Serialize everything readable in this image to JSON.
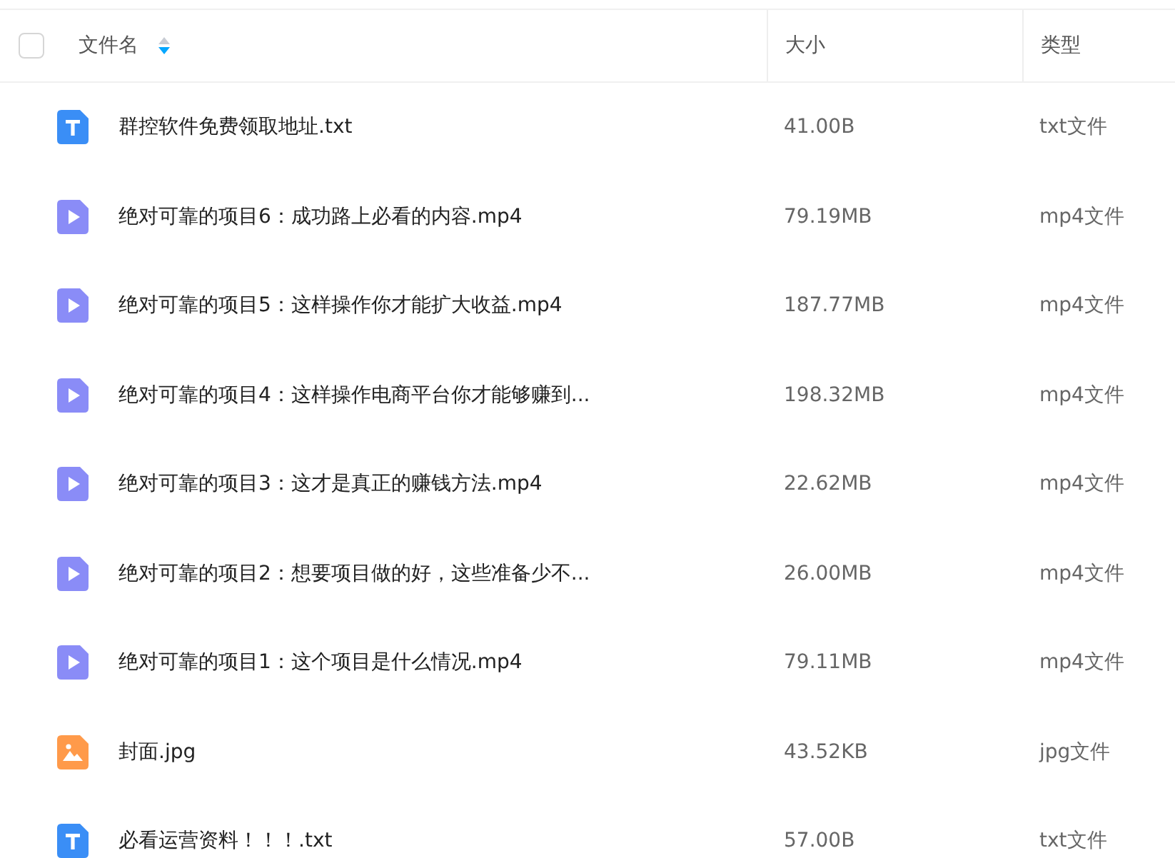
{
  "header": {
    "select_all": {
      "checked": false
    },
    "columns": [
      {
        "label": "文件名",
        "sorted": true
      },
      {
        "label": "大小",
        "sorted": false
      },
      {
        "label": "类型",
        "sorted": false
      }
    ]
  },
  "rows": [
    {
      "kind": "text",
      "name": "群控软件免费领取地址.txt",
      "size": "41.00B",
      "type": "txt文件"
    },
    {
      "kind": "video",
      "name": "绝对可靠的项目6：成功路上必看的内容.mp4",
      "size": "79.19MB",
      "type": "mp4文件"
    },
    {
      "kind": "video",
      "name": "绝对可靠的项目5：这样操作你才能扩大收益.mp4",
      "size": "187.77MB",
      "type": "mp4文件"
    },
    {
      "kind": "video",
      "name": "绝对可靠的项目4：这样操作电商平台你才能够赚到...",
      "size": "198.32MB",
      "type": "mp4文件"
    },
    {
      "kind": "video",
      "name": "绝对可靠的项目3：这才是真正的赚钱方法.mp4",
      "size": "22.62MB",
      "type": "mp4文件"
    },
    {
      "kind": "video",
      "name": "绝对可靠的项目2：想要项目做的好，这些准备少不...",
      "size": "26.00MB",
      "type": "mp4文件"
    },
    {
      "kind": "video",
      "name": "绝对可靠的项目1：这个项目是什么情况.mp4",
      "size": "79.11MB",
      "type": "mp4文件"
    },
    {
      "kind": "image",
      "name": "封面.jpg",
      "size": "43.52KB",
      "type": "jpg文件"
    },
    {
      "kind": "text",
      "name": "必看运营资料！！！.txt",
      "size": "57.00B",
      "type": "txt文件"
    }
  ]
}
